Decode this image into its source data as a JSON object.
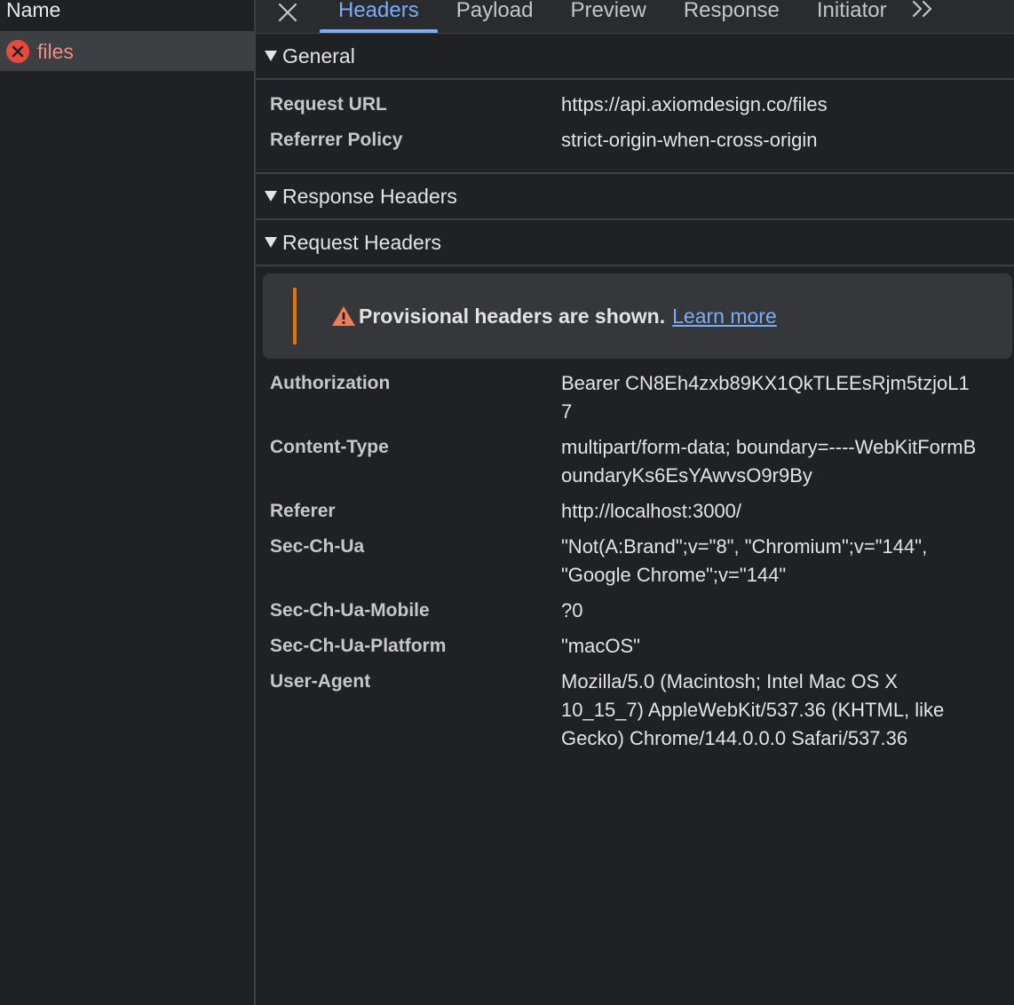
{
  "left": {
    "header": "Name",
    "file": {
      "name": "files",
      "status": "error"
    }
  },
  "tabs": {
    "items": [
      "Headers",
      "Payload",
      "Preview",
      "Response",
      "Initiator"
    ],
    "active": "Headers"
  },
  "sections": {
    "general": "General",
    "response": "Response Headers",
    "request": "Request Headers"
  },
  "general": [
    {
      "key": "Request URL",
      "value": "https://api.axiomdesign.co/files"
    },
    {
      "key": "Referrer Policy",
      "value": "strict-origin-when-cross-origin"
    }
  ],
  "warning": {
    "text": "Provisional headers are shown.",
    "link": "Learn more"
  },
  "request_headers": [
    {
      "key": "Authorization",
      "value": "Bearer CN8Eh4zxb89KX1QkTLEEsRjm5tzjoL17"
    },
    {
      "key": "Content-Type",
      "value": "multipart/form-data; boundary=----WebKitFormBoundaryKs6EsYAwvsO9r9By"
    },
    {
      "key": "Referer",
      "value": "http://localhost:3000/"
    },
    {
      "key": "Sec-Ch-Ua",
      "value": "\"Not(A:Brand\";v=\"8\", \"Chromium\";v=\"144\", \"Google Chrome\";v=\"144\""
    },
    {
      "key": "Sec-Ch-Ua-Mobile",
      "value": "?0"
    },
    {
      "key": "Sec-Ch-Ua-Platform",
      "value": "\"macOS\""
    },
    {
      "key": "User-Agent",
      "value": "Mozilla/5.0 (Macintosh; Intel Mac OS X 10_15_7) AppleWebKit/537.36 (KHTML, like Gecko) Chrome/144.0.0.0 Safari/537.36"
    }
  ],
  "colors": {
    "accent": "#7cacf8",
    "error": "#e64a3c",
    "warning": "#e37400"
  }
}
